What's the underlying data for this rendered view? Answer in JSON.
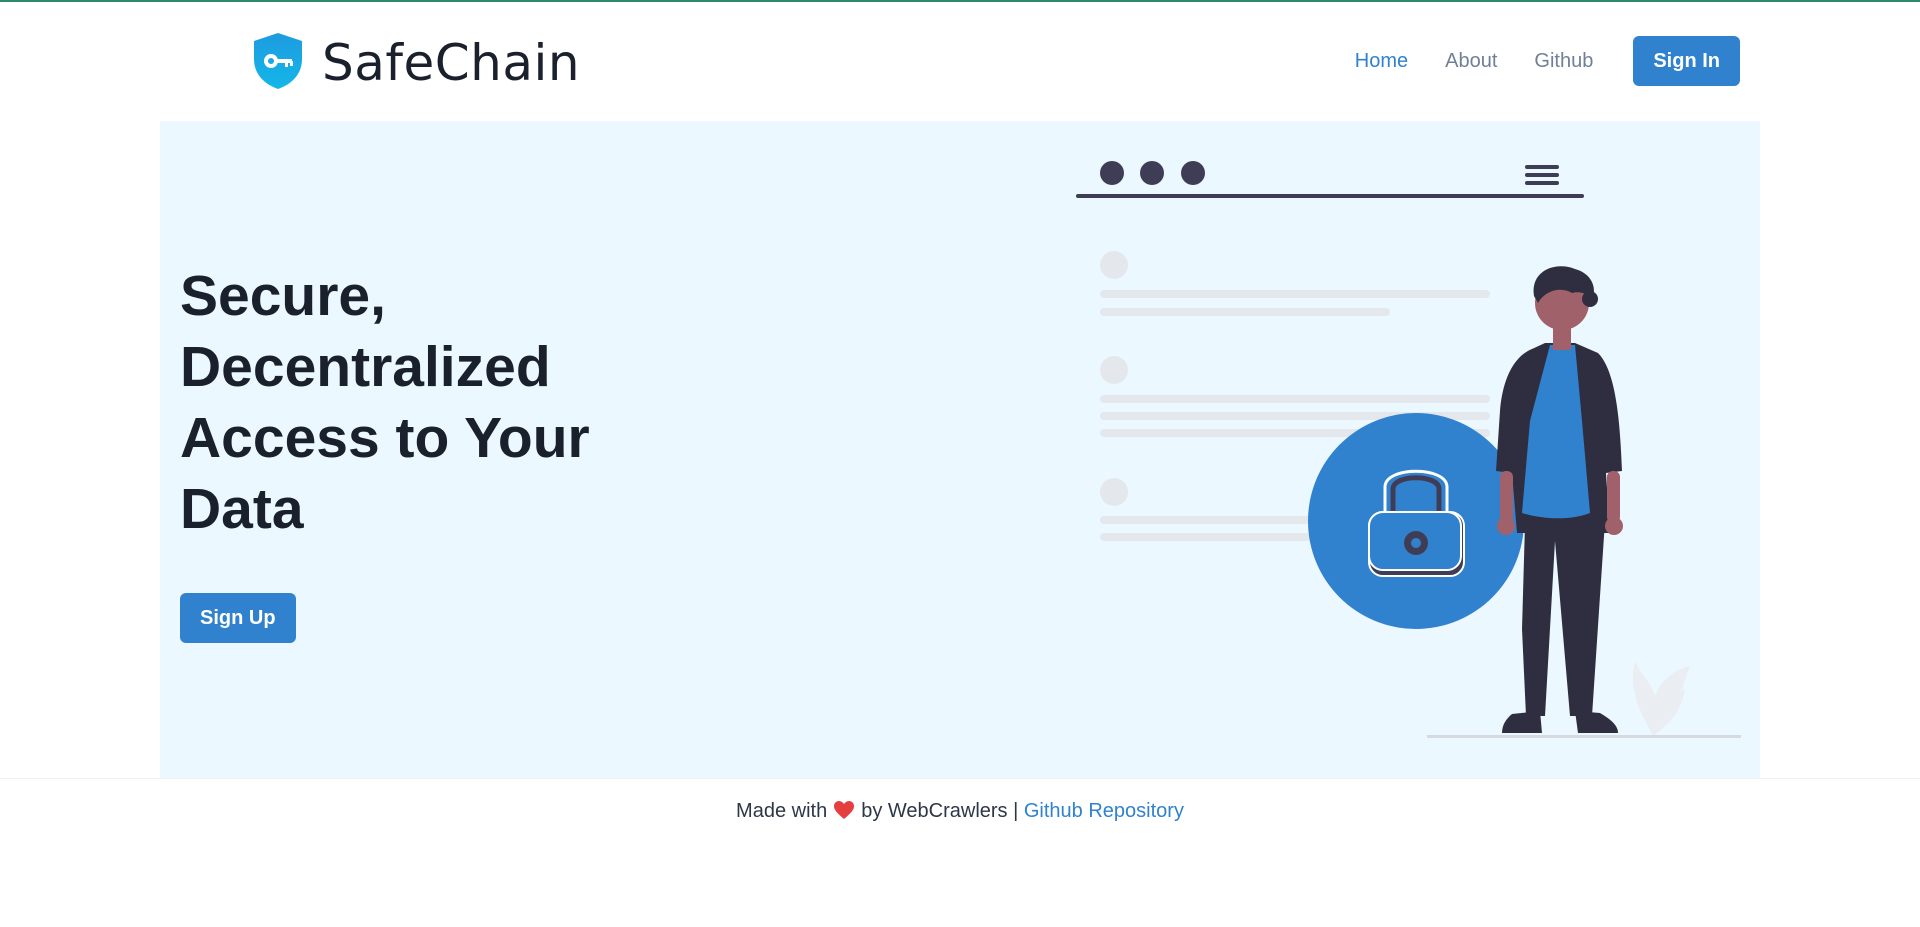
{
  "brand": {
    "name": "SafeChain",
    "logo_icon": "shield-key-icon"
  },
  "nav": {
    "links": [
      {
        "label": "Home",
        "active": true
      },
      {
        "label": "About",
        "active": false
      },
      {
        "label": "Github",
        "active": false
      }
    ],
    "signin_label": "Sign In"
  },
  "hero": {
    "title_lines": [
      "Secure,",
      "Decentralized",
      "Access to Your",
      "Data"
    ],
    "signup_label": "Sign Up",
    "illustration_icon": "person-padlock-illustration"
  },
  "footer": {
    "made_with": "Made with",
    "heart_icon": "heart-icon",
    "by_text": "by WebCrawlers |",
    "repo_link": "Github Repository"
  },
  "colors": {
    "accent": "#3182ce",
    "hero_bg": "#ebf8ff",
    "heading": "#1a202c",
    "nav_muted": "#718096"
  }
}
